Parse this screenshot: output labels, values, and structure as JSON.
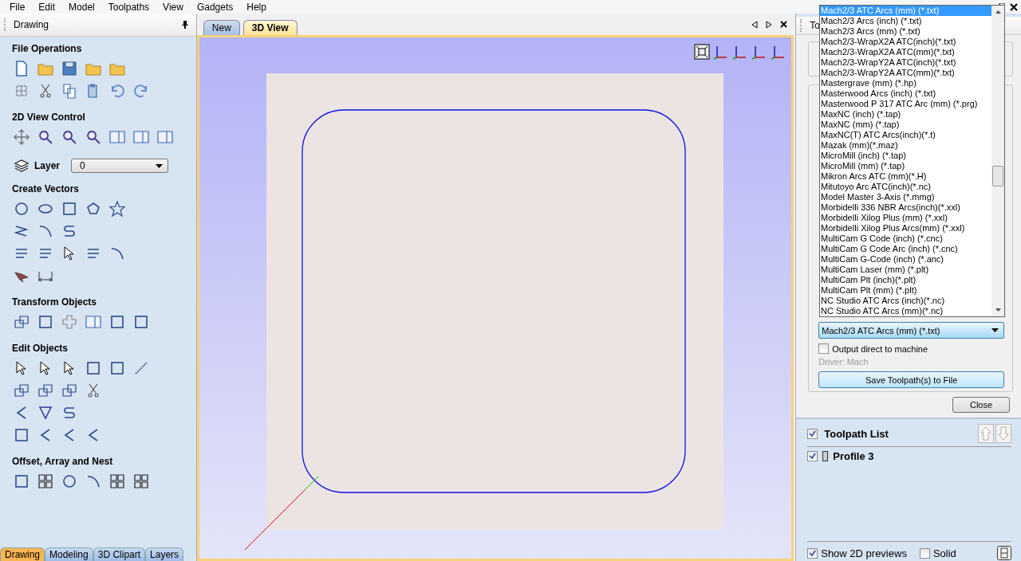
{
  "menu": [
    "File",
    "Edit",
    "Model",
    "Toolpaths",
    "View",
    "Gadgets",
    "Help"
  ],
  "left_panel": {
    "title": "Drawing",
    "sections": [
      {
        "title": "File Operations"
      },
      {
        "title": "2D View Control"
      },
      {
        "title": "Create Vectors"
      },
      {
        "title": "Transform Objects"
      },
      {
        "title": "Edit Objects"
      },
      {
        "title": "Offset, Array and Nest"
      }
    ],
    "layer": {
      "label": "Layer",
      "value": "0"
    },
    "tabs": [
      {
        "label": "Drawing",
        "selected": true
      },
      {
        "label": "Modeling",
        "selected": false
      },
      {
        "label": "3D Clipart",
        "selected": false
      },
      {
        "label": "Layers",
        "selected": false
      }
    ]
  },
  "view_tabs": [
    {
      "label": "New",
      "selected": false
    },
    {
      "label": "3D View",
      "selected": true
    }
  ],
  "right_panel": {
    "title": "To",
    "options": [
      {
        "label": "Mach2/3 ATC Arcs (mm) (*.txt)",
        "selected": true
      },
      {
        "label": "Mach2/3 Arcs (inch) (*.txt)",
        "selected": false
      },
      {
        "label": "Mach2/3 Arcs (mm) (*.txt)",
        "selected": false
      },
      {
        "label": "Mach2/3-WrapX2A ATC(inch)(*.txt)",
        "selected": false
      },
      {
        "label": "Mach2/3-WrapX2A ATC(mm)(*.txt)",
        "selected": false
      },
      {
        "label": "Mach2/3-WrapY2A ATC(inch)(*.txt)",
        "selected": false
      },
      {
        "label": "Mach2/3-WrapY2A ATC(mm)(*.txt)",
        "selected": false
      },
      {
        "label": "Mastergrave (mm) (*.hp)",
        "selected": false
      },
      {
        "label": "Masterwood Arcs (inch) (*.txt)",
        "selected": false
      },
      {
        "label": "Masterwood P 317 ATC Arc (mm) (*.prg)",
        "selected": false
      },
      {
        "label": "MaxNC (inch) (*.tap)",
        "selected": false
      },
      {
        "label": "MaxNC (mm) (*.tap)",
        "selected": false
      },
      {
        "label": "MaxNC(T) ATC Arcs(inch)(*.t)",
        "selected": false
      },
      {
        "label": "Mazak (mm)(*.maz)",
        "selected": false
      },
      {
        "label": "MicroMill (inch) (*.tap)",
        "selected": false
      },
      {
        "label": "MicroMill (mm) (*.tap)",
        "selected": false
      },
      {
        "label": "Mikron Arcs ATC (mm)(*.H)",
        "selected": false
      },
      {
        "label": "Mitutoyo Arc ATC(inch)(*.nc)",
        "selected": false
      },
      {
        "label": "Model Master 3-Axis (*.mmg)",
        "selected": false
      },
      {
        "label": "Morbidelli 336 NBR Arcs(inch)(*.xxl)",
        "selected": false
      },
      {
        "label": "Morbidelli Xilog Plus (mm) (*.xxl)",
        "selected": false
      },
      {
        "label": "Morbidelli Xilog Plus Arcs(mm) (*.xxl)",
        "selected": false
      },
      {
        "label": "MultiCam G Code (inch) (*.cnc)",
        "selected": false
      },
      {
        "label": "MultiCam G Code Arc (inch) (*.cnc)",
        "selected": false
      },
      {
        "label": "MultiCam G-Code (inch) (*.anc)",
        "selected": false
      },
      {
        "label": "MultiCam Laser (mm) (*.plt)",
        "selected": false
      },
      {
        "label": "MultiCam Plt (inch)(*.plt)",
        "selected": false
      },
      {
        "label": "MultiCam Plt (mm) (*.plt)",
        "selected": false
      },
      {
        "label": "NC Studio ATC Arcs (inch)(*.nc)",
        "selected": false
      },
      {
        "label": "NC Studio ATC Arcs (mm)(*.nc)",
        "selected": false
      }
    ],
    "post_processor": "Mach2/3 ATC Arcs (mm) (*.txt)",
    "output_direct": {
      "label": "Output direct to machine",
      "checked": false
    },
    "driver": "Driver: Mach",
    "save_button": "Save Toolpath(s) to File",
    "close_button": "Close"
  },
  "toolpath_list": {
    "title": "Toolpath List",
    "checked": true,
    "items": [
      {
        "name": "Profile 3",
        "checked": true
      }
    ],
    "show_previews": {
      "label": "Show 2D previews",
      "checked": true
    },
    "solid": {
      "label": "Solid",
      "checked": false
    }
  }
}
